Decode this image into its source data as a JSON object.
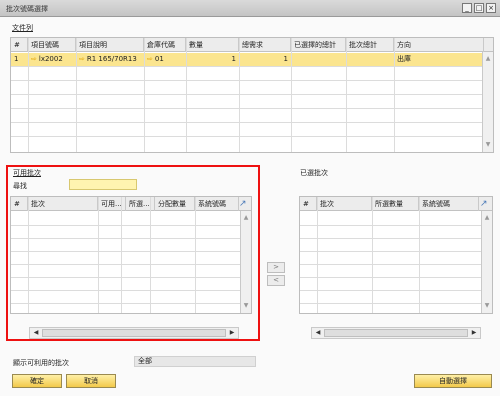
{
  "window": {
    "title": "批次號碼選擇",
    "buttons": {
      "minimize": "_",
      "maximize": "□",
      "close": "×"
    }
  },
  "documents": {
    "section_label": "文件列",
    "columns": [
      "#",
      "項目號碼",
      "項目說明",
      "倉庫代碼",
      "數量",
      "總需求",
      "已選擇的總計",
      "批次總計",
      "方向"
    ],
    "row": {
      "num": "1",
      "item_no": "lx2002",
      "item_desc": "R1 165/70R13",
      "warehouse": "01",
      "qty": "1",
      "total_needed": "1",
      "selected_total": "",
      "batch_total": "",
      "direction": "出庫"
    }
  },
  "available": {
    "section_label": "可用批次",
    "find_label": "尋找",
    "find_value": "",
    "columns": [
      "#",
      "批次",
      "可用...",
      "所選...",
      "分配數量",
      "系統號碼"
    ]
  },
  "selected": {
    "section_label": "已選批次",
    "columns": [
      "#",
      "批次",
      "所選數量",
      "系統號碼"
    ]
  },
  "transfer": {
    "add": ">",
    "remove": "<"
  },
  "footer": {
    "show_label": "顯示可利用的批次",
    "show_value": "全部",
    "ok": "確定",
    "cancel": "取消",
    "auto_select": "自動選擇"
  },
  "icons": {
    "expand": "↗",
    "scroll_up": "▲",
    "scroll_down": "▼",
    "scroll_left": "◀",
    "scroll_right": "▶",
    "row_arrow": "⇨"
  }
}
